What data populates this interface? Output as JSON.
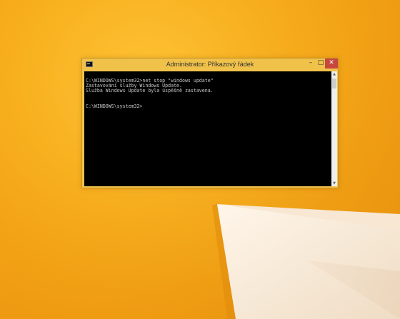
{
  "window": {
    "title": "Administrator: Příkazový řádek",
    "icon": "console-icon",
    "controls": {
      "minimize": "–",
      "maximize": "□",
      "close": "✕"
    }
  },
  "console": {
    "lines": [
      "C:\\WINDOWS\\system32>net stop \"windows update\"",
      "Zastavování služby Windows Update.",
      "Služba Windows Update byla úspěšně zastavena.",
      "",
      "",
      "C:\\WINDOWS\\system32>"
    ]
  },
  "colors": {
    "desktop": "#f4a51a",
    "window_frame": "#f0c24a",
    "close_button": "#c7463e",
    "console_bg": "#000000",
    "console_text": "#c8c8c8"
  }
}
